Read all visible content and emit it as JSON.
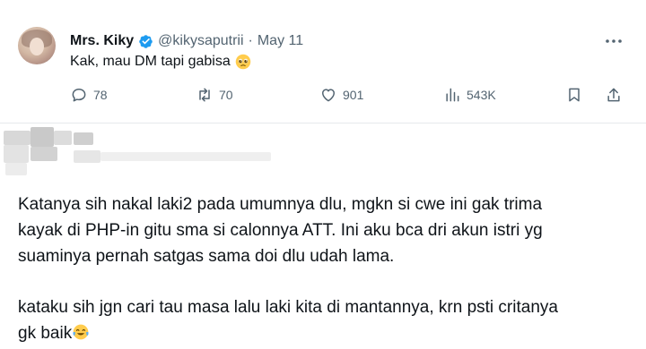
{
  "tweet": {
    "author_name": "Mrs. Kiky",
    "handle": "@kikysaputrii",
    "separator": "·",
    "date": "May 11",
    "text": "Kak, mau DM tapi gabisa",
    "text_emoji": "pleading-face-emoji",
    "stats": {
      "replies": "78",
      "reposts": "70",
      "likes": "901",
      "views": "543K"
    }
  },
  "reply": {
    "paragraph_1": [
      "Katanya sih nakal laki2 pada umumnya dlu, mgkn si cwe ini gak trima",
      "kayak di PHP-in gitu sma si calonnya ATT. Ini aku bca dri akun istri yg",
      "suaminya pernah satgas sama doi dlu udah lama."
    ],
    "paragraph_2": [
      "kataku sih jgn cari tau masa lalu laki kita di mantannya, krn psti critanya",
      "gk baik"
    ],
    "paragraph_2_emoji": "face-with-tears-of-joy-emoji"
  },
  "colors": {
    "verified_blue": "#1d9bf0",
    "secondary_text": "#536471",
    "primary_text": "#0f1419"
  }
}
